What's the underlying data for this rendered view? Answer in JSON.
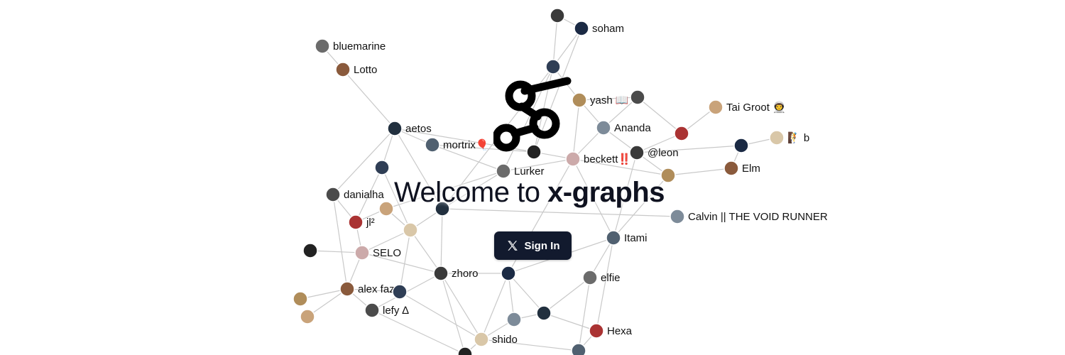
{
  "welcome": {
    "prefix": "Welcome to ",
    "brand": "x-graphs"
  },
  "signin": {
    "label": "Sign In",
    "icon": "x-logo-icon"
  },
  "logo": {
    "icon": "x-graphs-logo-icon"
  },
  "colors": {
    "button_bg": "#121a2e",
    "edge": "#c9c9c9",
    "text": "#0f1220"
  },
  "nodes": [
    {
      "id": "n0",
      "label": ""
    },
    {
      "id": "soham",
      "label": "soham"
    },
    {
      "id": "bluemarine",
      "label": "bluemarine"
    },
    {
      "id": "lotto",
      "label": "Lotto"
    },
    {
      "id": "n4",
      "label": ""
    },
    {
      "id": "yash",
      "label": "yash 📖"
    },
    {
      "id": "n6",
      "label": ""
    },
    {
      "id": "taigroot",
      "label": "Tai Groot 👨‍🚀"
    },
    {
      "id": "aetos",
      "label": "aetos"
    },
    {
      "id": "ananda",
      "label": "Ananda"
    },
    {
      "id": "n10",
      "label": ""
    },
    {
      "id": "b",
      "label": "🧗 b"
    },
    {
      "id": "mortrix",
      "label": "mortrix🎈"
    },
    {
      "id": "n13",
      "label": ""
    },
    {
      "id": "beckett",
      "label": "beckett‼️"
    },
    {
      "id": "leon",
      "label": "@leon"
    },
    {
      "id": "n16",
      "label": ""
    },
    {
      "id": "lurker",
      "label": "Lurker"
    },
    {
      "id": "elm",
      "label": "Elm"
    },
    {
      "id": "n19",
      "label": ""
    },
    {
      "id": "n20",
      "label": ""
    },
    {
      "id": "danialha",
      "label": "danialha"
    },
    {
      "id": "n22",
      "label": ""
    },
    {
      "id": "n23",
      "label": ""
    },
    {
      "id": "calvin",
      "label": "Calvin || THE VOID RUNNER"
    },
    {
      "id": "jl2",
      "label": "jl²"
    },
    {
      "id": "n26",
      "label": ""
    },
    {
      "id": "itami",
      "label": "Itami"
    },
    {
      "id": "n28",
      "label": ""
    },
    {
      "id": "selo",
      "label": "SELO"
    },
    {
      "id": "zhoro",
      "label": "zhoro"
    },
    {
      "id": "n31",
      "label": ""
    },
    {
      "id": "elfie",
      "label": "elfie"
    },
    {
      "id": "alexfaz",
      "label": "alex faz"
    },
    {
      "id": "n34",
      "label": ""
    },
    {
      "id": "n35",
      "label": ""
    },
    {
      "id": "lefy",
      "label": "lefy ∆"
    },
    {
      "id": "n37",
      "label": ""
    },
    {
      "id": "n38",
      "label": ""
    },
    {
      "id": "n39",
      "label": ""
    },
    {
      "id": "hexa",
      "label": "Hexa"
    },
    {
      "id": "shido",
      "label": "shido"
    },
    {
      "id": "n42",
      "label": ""
    },
    {
      "id": "n43",
      "label": ""
    }
  ]
}
